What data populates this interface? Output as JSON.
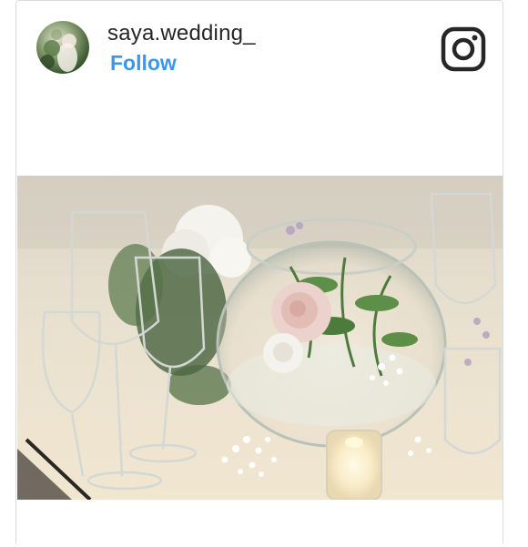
{
  "post": {
    "username": "saya.wedding_",
    "follow_label": "Follow",
    "platform_icon": "instagram-icon",
    "photo_icon": "table-centerpiece-photo"
  },
  "colors": {
    "follow": "#3897f0",
    "text": "#262626",
    "border": "#dbdbdb"
  }
}
